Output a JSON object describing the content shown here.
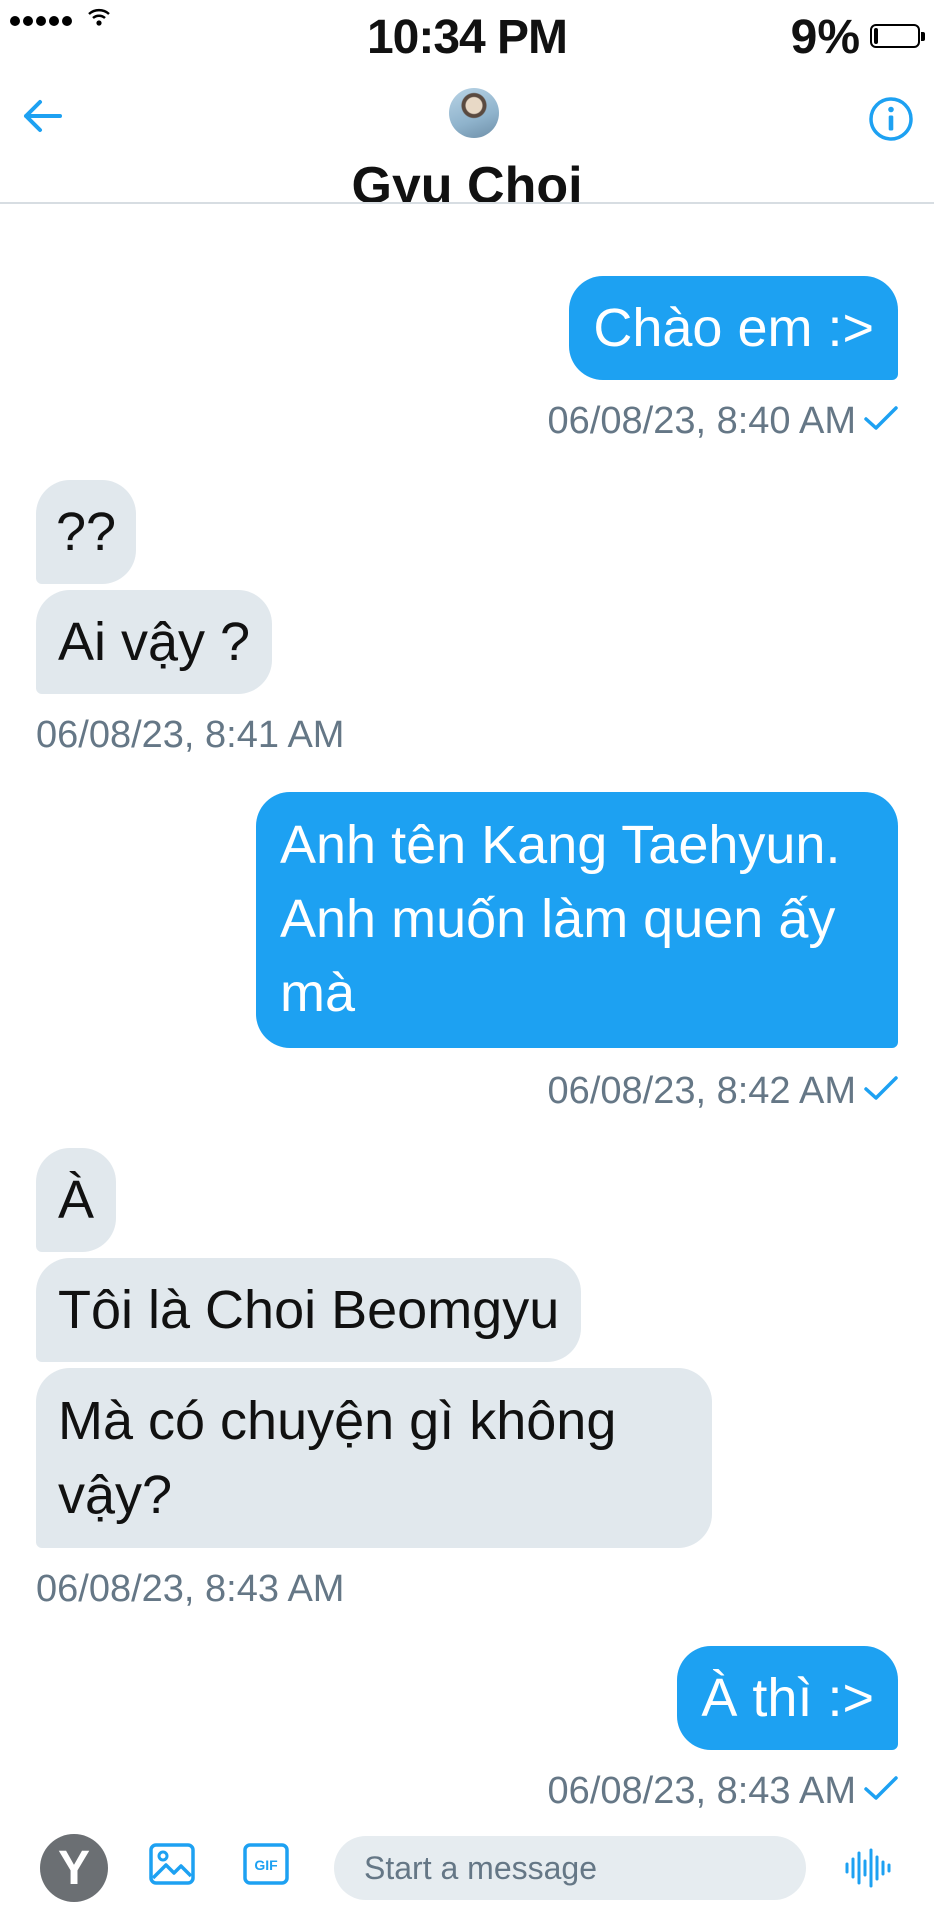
{
  "status_bar": {
    "time": "10:34 PM",
    "battery_percent": "9%",
    "signal_bars": 5,
    "wifi_icon": "wifi-icon",
    "battery_icon": "battery-icon"
  },
  "header": {
    "back_icon": "arrow-left-icon",
    "avatar": "contact-avatar",
    "contact_name": "Gyu Choi",
    "info_icon": "info-icon"
  },
  "conversation": {
    "messages": [
      {
        "direction": "outgoing",
        "text": "Chào em :>"
      },
      {
        "direction": "outgoing",
        "timestamp": "06/08/23, 8:40 AM",
        "read": true
      },
      {
        "direction": "incoming",
        "text": "??"
      },
      {
        "direction": "incoming",
        "text": "Ai vậy ?"
      },
      {
        "direction": "incoming",
        "timestamp": "06/08/23, 8:41 AM"
      },
      {
        "direction": "outgoing",
        "text": "Anh tên Kang Taehyun. Anh muốn làm quen ấy mà"
      },
      {
        "direction": "outgoing",
        "timestamp": "06/08/23, 8:42 AM",
        "read": true
      },
      {
        "direction": "incoming",
        "text": "À"
      },
      {
        "direction": "incoming",
        "text": "Tôi là Choi Beomgyu"
      },
      {
        "direction": "incoming",
        "text": "Mà có chuyện gì không vậy?"
      },
      {
        "direction": "incoming",
        "timestamp": "06/08/23, 8:43 AM"
      },
      {
        "direction": "outgoing",
        "text": "À thì :>"
      },
      {
        "direction": "outgoing",
        "timestamp": "06/08/23, 8:43 AM",
        "read": true
      }
    ]
  },
  "composer": {
    "account_avatar_letter": "Y",
    "media_icon": "image-icon",
    "gif_label": "GIF",
    "placeholder": "Start a message",
    "value": "",
    "voice_icon": "voice-waveform-icon"
  },
  "colors": {
    "accent": "#1da1f2",
    "incoming_bubble": "#e1e8ed",
    "timestamp": "#657786"
  }
}
